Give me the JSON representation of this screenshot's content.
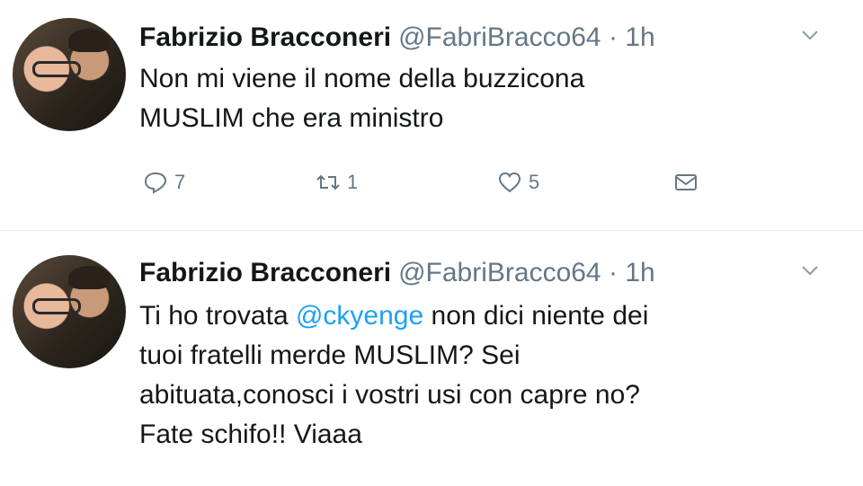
{
  "tweets": [
    {
      "author_name": "Fabrizio Bracconeri",
      "handle": "@FabriBracco64",
      "separator": "·",
      "time": "1h",
      "text_lines": [
        "Non mi viene il nome della buzzicona",
        "MUSLIM che era ministro"
      ],
      "reply_count": "7",
      "retweet_count": "1",
      "like_count": "5"
    },
    {
      "author_name": "Fabrizio Bracconeri",
      "handle": "@FabriBracco64",
      "separator": "·",
      "time": "1h",
      "text_prefix": "Ti ho trovata ",
      "mention": "@ckyenge",
      "text_suffix": " non dici niente dei",
      "text_lines": [
        "tuoi fratelli merde MUSLIM? Sei",
        "abituata,conosci i vostri usi con capre no?",
        "Fate schifo!! Viaaa"
      ]
    }
  ],
  "colors": {
    "text": "#14171a",
    "secondary": "#657786",
    "mention": "#1da1f2"
  },
  "icons": [
    "reply-icon",
    "retweet-icon",
    "like-icon",
    "direct-message-icon",
    "chevron-down-icon"
  ]
}
